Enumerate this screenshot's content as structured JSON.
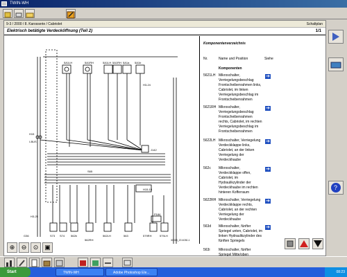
{
  "window": {
    "title": "TWIN-WH"
  },
  "breadcrumb": {
    "path": "9-3 / 2000 / 8. Karosserie / Cabriolet",
    "right": "Schaltplan"
  },
  "section": {
    "title": "Elektrisch betätigte Verdeckôffnung (Teil 2)",
    "page": "1/1"
  },
  "diagram_labels": {
    "top": [
      "5A1LH",
      "5A1RH",
      "5A1LH",
      "5A1RH",
      "5A1a",
      "5A1b"
    ],
    "h15": "H15",
    "ibus": "I-BUS",
    "j142": "J142",
    "h15_15": "H15-15",
    "h3_24": "H3-24",
    "p184": "P184",
    "h3_25": "H3-25",
    "g36": "G36",
    "s65": "S65",
    "bottom": [
      "S73",
      "S74",
      "562b",
      "562RH",
      "562LH",
      "563",
      "579RH",
      "579LH"
    ],
    "code": "30008_20 4030-1"
  },
  "components": {
    "heading": "Komponentenverzeichnis",
    "col_nr": "Nr.",
    "col_name": "Name und Position",
    "col_view": "Siehe",
    "group": "Komponenten",
    "rows": [
      {
        "id": "5621LH",
        "desc": "Mikroschalter, Verriegelungsbeschlag Frontscheibenrahmen links, Cabriolet, im linken Verriegelungsbeschlag im Frontscheibenrahmen"
      },
      {
        "id": "5621RH",
        "desc": "Mikroschalter, Verriegelungsbeschlag Frontscheibenrahmen rechts, Cabriolet, im rechten Verriegelungsbeschlag im Frontscheibenrahmen"
      },
      {
        "id": "5622LH",
        "desc": "Mikroschalter, Verriegelung Verdeckklappe links, Cabriolet, an der linken Verriegelung der Verdeckhaube"
      },
      {
        "id": "562c",
        "desc": "Mikroschalter, Verdeckklappe offen, Cabriolet, im Hydraulikzylinder der Verdeckhaube im rechten hinteren Kofferraum"
      },
      {
        "id": "5622RH",
        "desc": "Mikroschalter, Verriegelung Verdeckklappe rechts, Cabriolet, an der rechten Verriegelung der Verdeckhaube"
      },
      {
        "id": "563d",
        "desc": "Mikroschalter, fünfter Spriegel unten, Cabriolet, im linken Hydraulikzylinder des fünften Spriegels"
      },
      {
        "id": "563i",
        "desc": "Mikroschalter, fünfter Spriegel Mitte/oben"
      }
    ]
  },
  "taskbar": {
    "start": "Start",
    "tasks": [
      "TWIN-WH",
      "Adobe Photoshop Ele..."
    ],
    "clock": "08:23"
  },
  "icons": {
    "view_button": "arrow-right-icon",
    "nav": [
      "stop-icon",
      "arrow-up-icon",
      "arrow-down-icon"
    ]
  },
  "colors": {
    "view_button": "#2050c0",
    "nav_up": "#d02020",
    "title_bar": "#0a246a"
  }
}
